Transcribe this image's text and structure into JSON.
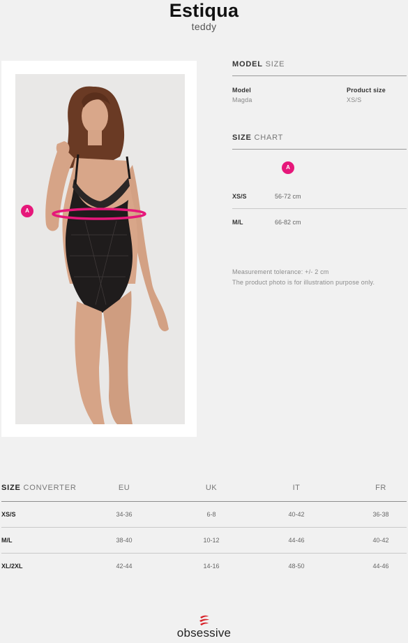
{
  "product": {
    "name": "Estiqua",
    "type": "teddy"
  },
  "model_size": {
    "heading_bold": "MODEL",
    "heading_light": "SIZE",
    "model_label": "Model",
    "model_value": "Magda",
    "size_label": "Product size",
    "size_value": "XS/S"
  },
  "size_chart": {
    "heading_bold": "SIZE",
    "heading_light": "CHART",
    "marker": "A",
    "rows": [
      {
        "size": "XS/S",
        "value": "56-72 cm"
      },
      {
        "size": "M/L",
        "value": "66-82 cm"
      }
    ],
    "notes": [
      "Measurement tolerance: +/- 2 cm",
      "The product photo is for illustration purpose only."
    ]
  },
  "photo": {
    "marker": "A",
    "accent_color": "#e6177a"
  },
  "size_converter": {
    "heading_bold": "SIZE",
    "heading_light": "CONVERTER",
    "columns": [
      "EU",
      "UK",
      "IT",
      "FR"
    ],
    "rows": [
      {
        "size": "XS/S",
        "cells": [
          "34-36",
          "6-8",
          "40-42",
          "36-38"
        ]
      },
      {
        "size": "M/L",
        "cells": [
          "38-40",
          "10-12",
          "44-46",
          "40-42"
        ]
      },
      {
        "size": "XL/2XL",
        "cells": [
          "42-44",
          "14-16",
          "48-50",
          "44-46"
        ]
      }
    ]
  },
  "brand": {
    "name": "obsessive",
    "color": "#d8232a"
  }
}
